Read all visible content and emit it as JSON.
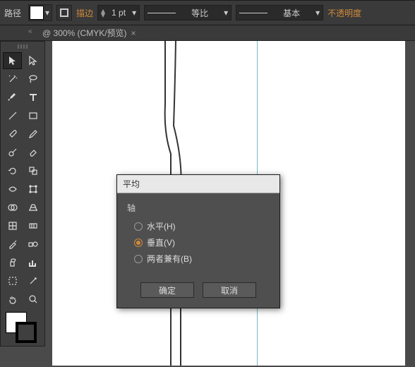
{
  "topbar": {
    "path_label": "路径",
    "stroke_label": "描边",
    "stroke_weight": "1 pt",
    "profile_label": "等比",
    "brush_label": "基本",
    "opacity_label": "不透明度"
  },
  "tab": {
    "title": "@ 300% (CMYK/预览)",
    "chevrons": "«"
  },
  "dialog": {
    "title": "平均",
    "group": "轴",
    "opt_h": "水平(H)",
    "opt_v": "垂直(V)",
    "opt_b": "两者兼有(B)",
    "ok": "确定",
    "cancel": "取消"
  }
}
